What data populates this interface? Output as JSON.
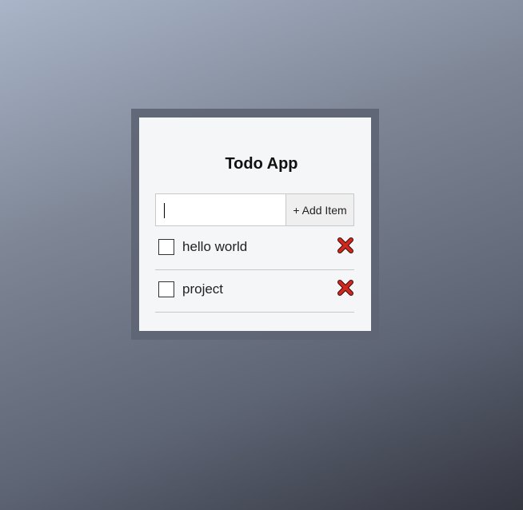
{
  "app": {
    "title": "Todo App"
  },
  "new_item": {
    "value": "",
    "add_button_label": "+ Add Item"
  },
  "todo_items": [
    {
      "label": "hello world",
      "checked": false,
      "delete_icon": "x-delete-icon"
    },
    {
      "label": "project",
      "checked": false,
      "delete_icon": "x-delete-icon"
    }
  ],
  "colors": {
    "delete_icon": "#d0281e",
    "card_background": "#f5f6f7",
    "frame": "#5f6575"
  }
}
